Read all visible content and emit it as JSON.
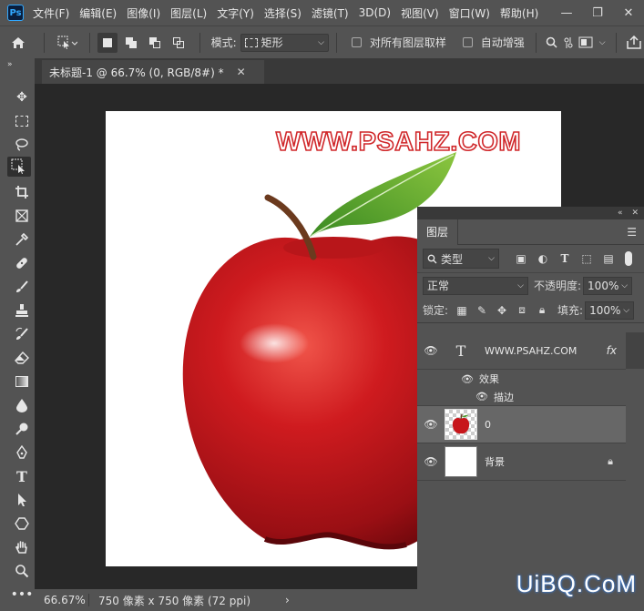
{
  "app": {
    "logo": "Ps",
    "menus": [
      "文件(F)",
      "编辑(E)",
      "图像(I)",
      "图层(L)",
      "文字(Y)",
      "选择(S)",
      "滤镜(T)",
      "3D(D)",
      "视图(V)",
      "窗口(W)",
      "帮助(H)"
    ]
  },
  "options": {
    "mode_label": "模式:",
    "mode_value": "矩形",
    "sample_all_label": "对所有图层取样",
    "auto_enhance_label": "自动增强"
  },
  "document": {
    "tab_title": "未标题-1 @ 66.7% (0, RGB/8#) *",
    "watermark_text": "WWW.PSAHZ.COM"
  },
  "status": {
    "zoom": "66.67%",
    "info": "750 像素 x 750 像素 (72 ppi)"
  },
  "corner_watermark": "UiBQ.CoM",
  "layers_panel": {
    "tab": "图层",
    "filter_kind": "类型",
    "blend_mode": "正常",
    "opacity_label": "不透明度:",
    "opacity_value": "100%",
    "lock_label": "锁定:",
    "fill_label": "填充:",
    "fill_value": "100%",
    "layers": [
      {
        "name": "WWW.PSAHZ.COM",
        "kind": "text",
        "fx": "fx",
        "effects_label": "效果",
        "effect": "描边"
      },
      {
        "name": "0",
        "kind": "image",
        "selected": true
      },
      {
        "name": "背景",
        "kind": "background",
        "locked": true
      }
    ]
  },
  "colors": {
    "watermark_stroke": "#d0282b",
    "apple_red": "#c7161b",
    "leaf_green": "#4a9a2a"
  }
}
